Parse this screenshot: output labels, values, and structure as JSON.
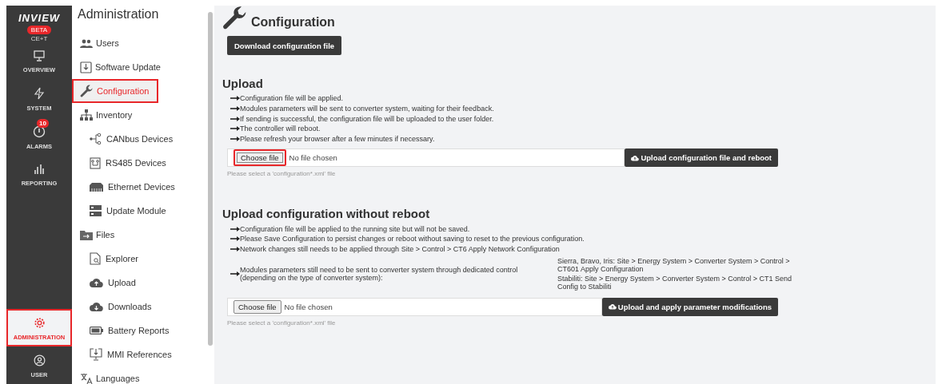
{
  "brand": {
    "logo": "INVIEW",
    "badge": "BETA",
    "subtitle": "CE+T"
  },
  "nav": [
    {
      "label": "OVERVIEW",
      "selected": false,
      "highlighted": false
    },
    {
      "label": "SYSTEM",
      "selected": false,
      "highlighted": false
    },
    {
      "label": "ALARMS",
      "selected": false,
      "highlighted": false,
      "badge": "10"
    },
    {
      "label": "REPORTING",
      "selected": false,
      "highlighted": false
    },
    {
      "label": "ADMINISTRATION",
      "selected": true,
      "highlighted": true
    },
    {
      "label": "USER",
      "selected": false,
      "highlighted": false
    }
  ],
  "submenu": {
    "title": "Administration",
    "items": [
      {
        "label": "Users",
        "selected": false,
        "highlighted": false
      },
      {
        "label": "Software Update",
        "selected": false,
        "highlighted": false
      },
      {
        "label": "Configuration",
        "selected": true,
        "highlighted": true
      },
      {
        "label": "Inventory",
        "selected": false,
        "highlighted": false,
        "children": [
          {
            "label": "CANbus Devices",
            "selected": false,
            "highlighted": false
          },
          {
            "label": "RS485 Devices",
            "selected": false,
            "highlighted": false
          },
          {
            "label": "Ethernet Devices",
            "selected": false,
            "highlighted": false
          },
          {
            "label": "Update Module",
            "selected": false,
            "highlighted": false
          }
        ]
      },
      {
        "label": "Files",
        "selected": false,
        "highlighted": false,
        "children": [
          {
            "label": "Explorer",
            "selected": false,
            "highlighted": false
          },
          {
            "label": "Upload",
            "selected": false,
            "highlighted": false
          },
          {
            "label": "Downloads",
            "selected": false,
            "highlighted": false
          },
          {
            "label": "Battery Reports",
            "selected": false,
            "highlighted": false
          },
          {
            "label": "MMI References",
            "selected": false,
            "highlighted": false
          }
        ]
      },
      {
        "label": "Languages",
        "selected": false,
        "highlighted": false
      }
    ]
  },
  "page": {
    "title": "Configuration",
    "download_button": "Download configuration file",
    "sections": [
      {
        "heading": "Upload",
        "notes": [
          {
            "text": "Configuration file will be applied."
          },
          {
            "text": "Modules parameters will be sent to converter system, waiting for their feedback."
          },
          {
            "text": "If sending is successful, the configuration file will be uploaded to the user folder."
          },
          {
            "text": "The controller will reboot."
          },
          {
            "text": "Please refresh your browser after a few minutes if necessary."
          }
        ],
        "file_button": "Choose file",
        "file_button_highlighted": true,
        "file_status": "No file chosen",
        "submit": "Upload configuration file and reboot",
        "hint": "Please select a 'configuration*.xml' file"
      },
      {
        "heading": "Upload configuration without reboot",
        "notes": [
          {
            "text": "Configuration file will be applied to the running site but will not be saved."
          },
          {
            "text": "Please Save Configuration to persist changes or reboot without saving to reset to the previous configuration."
          },
          {
            "text": "Network changes still needs to be applied through Site > Control > CT6 Apply Network Configuration"
          },
          {
            "text": "Modules parameters still need to be sent to converter system through dedicated control (depending on the type of converter system):",
            "details": [
              "Sierra, Bravo, Iris: Site > Energy System > Converter System > Control > CT601 Apply Configuration",
              "Stabiliti: Site > Energy System > Converter System > Control > CT1 Send Config to Stabiliti"
            ]
          }
        ],
        "file_button": "Choose file",
        "file_button_highlighted": false,
        "file_status": "No file chosen",
        "submit": "Upload and apply parameter modifications",
        "hint": "Please select a 'configuration*.xml' file"
      }
    ]
  }
}
